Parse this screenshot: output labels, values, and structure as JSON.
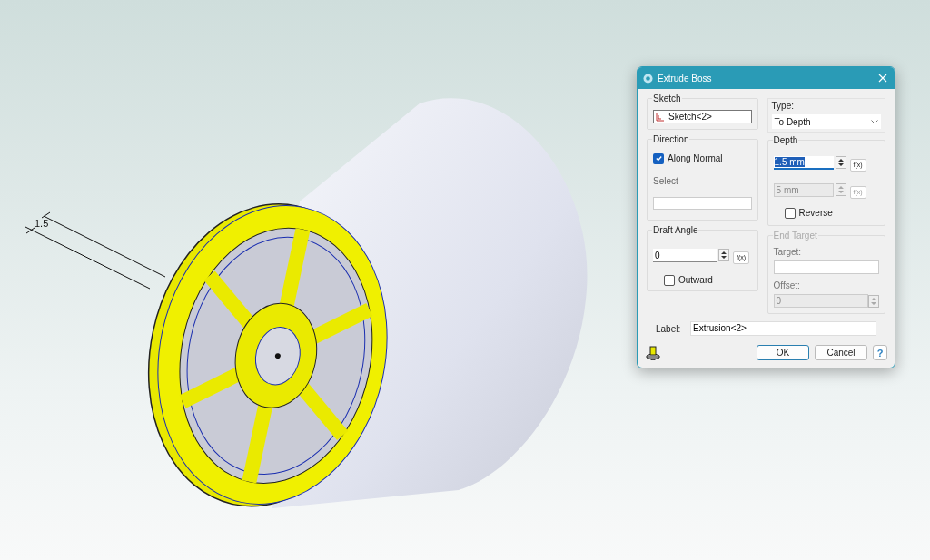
{
  "viewport": {
    "dimension": "1.5"
  },
  "dialog": {
    "title": "Extrude Boss",
    "sketch": {
      "label": "Sketch",
      "value": "Sketch<2>"
    },
    "type": {
      "label": "Type:",
      "value": "To Depth"
    },
    "direction": {
      "label": "Direction",
      "along_normal": {
        "label": "Along Normal",
        "checked": true
      },
      "select_label": "Select"
    },
    "depth": {
      "label": "Depth",
      "value": "1.5 mm",
      "fx": "f(x)",
      "second_value": "5 mm",
      "second_fx": "f(x)",
      "second_disabled": true,
      "reverse": {
        "label": "Reverse",
        "checked": false
      }
    },
    "draft_angle": {
      "label": "Draft Angle",
      "value": "0",
      "fx": "f(x)",
      "outward": {
        "label": "Outward",
        "checked": false
      }
    },
    "end_target": {
      "label": "End Target",
      "disabled": true,
      "target_label": "Target:",
      "offset_label": "Offset:",
      "offset_value": "0"
    },
    "label_field": {
      "label": "Label:",
      "value": "Extrusion<2>"
    },
    "buttons": [
      {
        "label": "OK",
        "default": true
      },
      {
        "label": "Cancel",
        "default": false
      }
    ],
    "help": "?"
  }
}
